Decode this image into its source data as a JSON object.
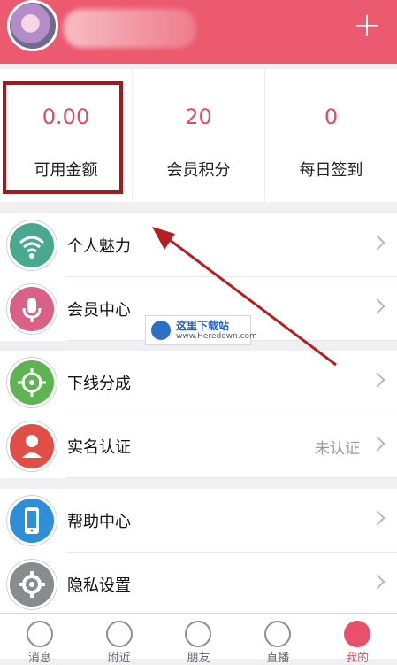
{
  "stats": [
    {
      "value": "0.00",
      "label": "可用金额"
    },
    {
      "value": "20",
      "label": "会员积分"
    },
    {
      "value": "0",
      "label": "每日签到"
    }
  ],
  "menu": [
    {
      "label": "个人魅力",
      "icon": "wifi-icon"
    },
    {
      "label": "会员中心",
      "icon": "microphone-icon"
    },
    {
      "label": "下线分成",
      "icon": "target-icon"
    },
    {
      "label": "实名认证",
      "icon": "user-icon",
      "status": "未认证"
    },
    {
      "label": "帮助中心",
      "icon": "phone-icon"
    },
    {
      "label": "隐私设置",
      "icon": "gear-icon"
    }
  ],
  "watermark": {
    "title": "这里下载站",
    "url": "www.Heredown.com"
  },
  "tabbar": [
    {
      "label": "消息",
      "icon": "chat-icon"
    },
    {
      "label": "附近",
      "icon": "home-icon"
    },
    {
      "label": "朋友",
      "icon": "user-icon"
    },
    {
      "label": "直播",
      "icon": "play-icon"
    },
    {
      "label": "我的",
      "icon": "gear-icon",
      "active": true
    }
  ],
  "colors": {
    "accent": "#eb5a6e",
    "highlight": "#9f1b1f"
  }
}
